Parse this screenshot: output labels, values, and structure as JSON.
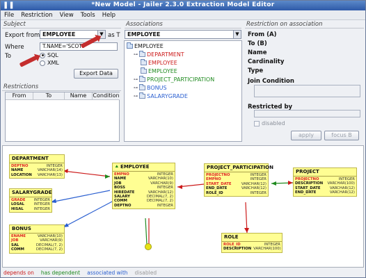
{
  "window": {
    "title": "*New Model - Jailer 2.3.0 Extraction Model Editor",
    "app_icon": "jailer-app-icon"
  },
  "menu": [
    "File",
    "Restriction",
    "View",
    "Tools",
    "Help"
  ],
  "subject": {
    "header": "Subject",
    "export_from_label": "Export from",
    "export_from_value": "EMPLOYEE",
    "as_t_label": "as T",
    "where_label": "Where",
    "where_value": "T.NAME='SCOTT'",
    "to_label": "To",
    "format_sql": "SQL",
    "format_xml": "XML",
    "format_selected": "SQL",
    "export_button": "Export Data"
  },
  "restrictions": {
    "header": "Restrictions",
    "columns": [
      "From",
      "To",
      "Name",
      "Condition"
    ]
  },
  "associations": {
    "header": "Associations",
    "selected": "EMPLOYEE",
    "tree": [
      {
        "label": "EMPLOYEE",
        "color": "#111111",
        "indent": 0,
        "toggle": "",
        "root": true
      },
      {
        "label": "DEPARTMENT",
        "color": "#cc1a1a",
        "indent": 1,
        "toggle": "+"
      },
      {
        "label": "EMPLOYEE",
        "color": "#cc1a1a",
        "indent": 2,
        "toggle": ""
      },
      {
        "label": "EMPLOYEE",
        "color": "#1f8a1f",
        "indent": 2,
        "toggle": ""
      },
      {
        "label": "PROJECT_PARTICIPATION",
        "color": "#1f8a1f",
        "indent": 1,
        "toggle": "+"
      },
      {
        "label": "BONUS",
        "color": "#2a5fd0",
        "indent": 1,
        "toggle": "+"
      },
      {
        "label": "SALARYGRADE",
        "color": "#2a5fd0",
        "indent": 1,
        "toggle": "+"
      }
    ]
  },
  "restriction_on_association": {
    "header": "Restriction on association",
    "fields": [
      "From (A)",
      "To (B)",
      "Name",
      "Cardinality",
      "Type"
    ],
    "join_condition_label": "Join Condition",
    "restricted_by_label": "Restricted by",
    "disabled_label": "disabled",
    "apply_button": "apply",
    "focus_button": "focus B"
  },
  "diagram": {
    "entities": [
      {
        "id": "DEPARTMENT",
        "rows": [
          [
            "DEPTNO",
            "INTEGER",
            true
          ],
          [
            "NAME",
            "VARCHAR(14)",
            false
          ],
          [
            "LOCATION",
            "VARCHAR(13)",
            false
          ]
        ]
      },
      {
        "id": "SALARYGRADE",
        "rows": [
          [
            "GRADE",
            "INTEGER",
            true
          ],
          [
            "LOSAL",
            "INTEGER",
            false
          ],
          [
            "HISAL",
            "INTEGER",
            false
          ]
        ]
      },
      {
        "id": "BONUS",
        "rows": [
          [
            "ENAME",
            "VARCHAR(10)",
            true
          ],
          [
            "JOB",
            "VARCHAR(9)",
            true
          ],
          [
            "SAL",
            "DECIMAL(7, 2)",
            false
          ],
          [
            "COMM",
            "DECIMAL(7, 2)",
            false
          ]
        ]
      },
      {
        "id": "EMPLOYEE",
        "rows": [
          [
            "EMPNO",
            "INTEGER",
            true
          ],
          [
            "NAME",
            "VARCHAR(10)",
            false
          ],
          [
            "JOB",
            "VARCHAR(9)",
            false
          ],
          [
            "BOSS",
            "INTEGER",
            false
          ],
          [
            "HIREDATE",
            "VARCHAR(12)",
            false
          ],
          [
            "SALARY",
            "DECIMAL(7, 2)",
            false
          ],
          [
            "COMM",
            "DECIMAL(7, 2)",
            false
          ],
          [
            "DEPTNO",
            "INTEGER",
            false
          ]
        ]
      },
      {
        "id": "PROJECT_PARTICIPATION",
        "rows": [
          [
            "PROJECTNO",
            "INTEGER",
            true
          ],
          [
            "EMPNO",
            "INTEGER",
            true
          ],
          [
            "START_DATE",
            "VARCHAR(12)",
            true
          ],
          [
            "END_DATE",
            "VARCHAR(12)",
            false
          ],
          [
            "ROLE_ID",
            "INTEGER",
            false
          ]
        ]
      },
      {
        "id": "PROJECT",
        "rows": [
          [
            "PROJECTNO",
            "INTEGER",
            true
          ],
          [
            "DESCRIPTION",
            "VARCHAR(100)",
            false
          ],
          [
            "START_DATE",
            "VARCHAR(12)",
            false
          ],
          [
            "END_DATE",
            "VARCHAR(12)",
            false
          ]
        ]
      },
      {
        "id": "ROLE",
        "rows": [
          [
            "ROLE_ID",
            "INTEGER",
            true
          ],
          [
            "DESCRIPTION",
            "VARCHAR(100)",
            false
          ]
        ]
      }
    ]
  },
  "legend": [
    {
      "label": "depends on",
      "color": "#cc1a1a"
    },
    {
      "label": "has dependent",
      "color": "#1f8a1f"
    },
    {
      "label": "associated with",
      "color": "#2a5fd0"
    },
    {
      "label": "disabled",
      "color": "#999999"
    }
  ]
}
